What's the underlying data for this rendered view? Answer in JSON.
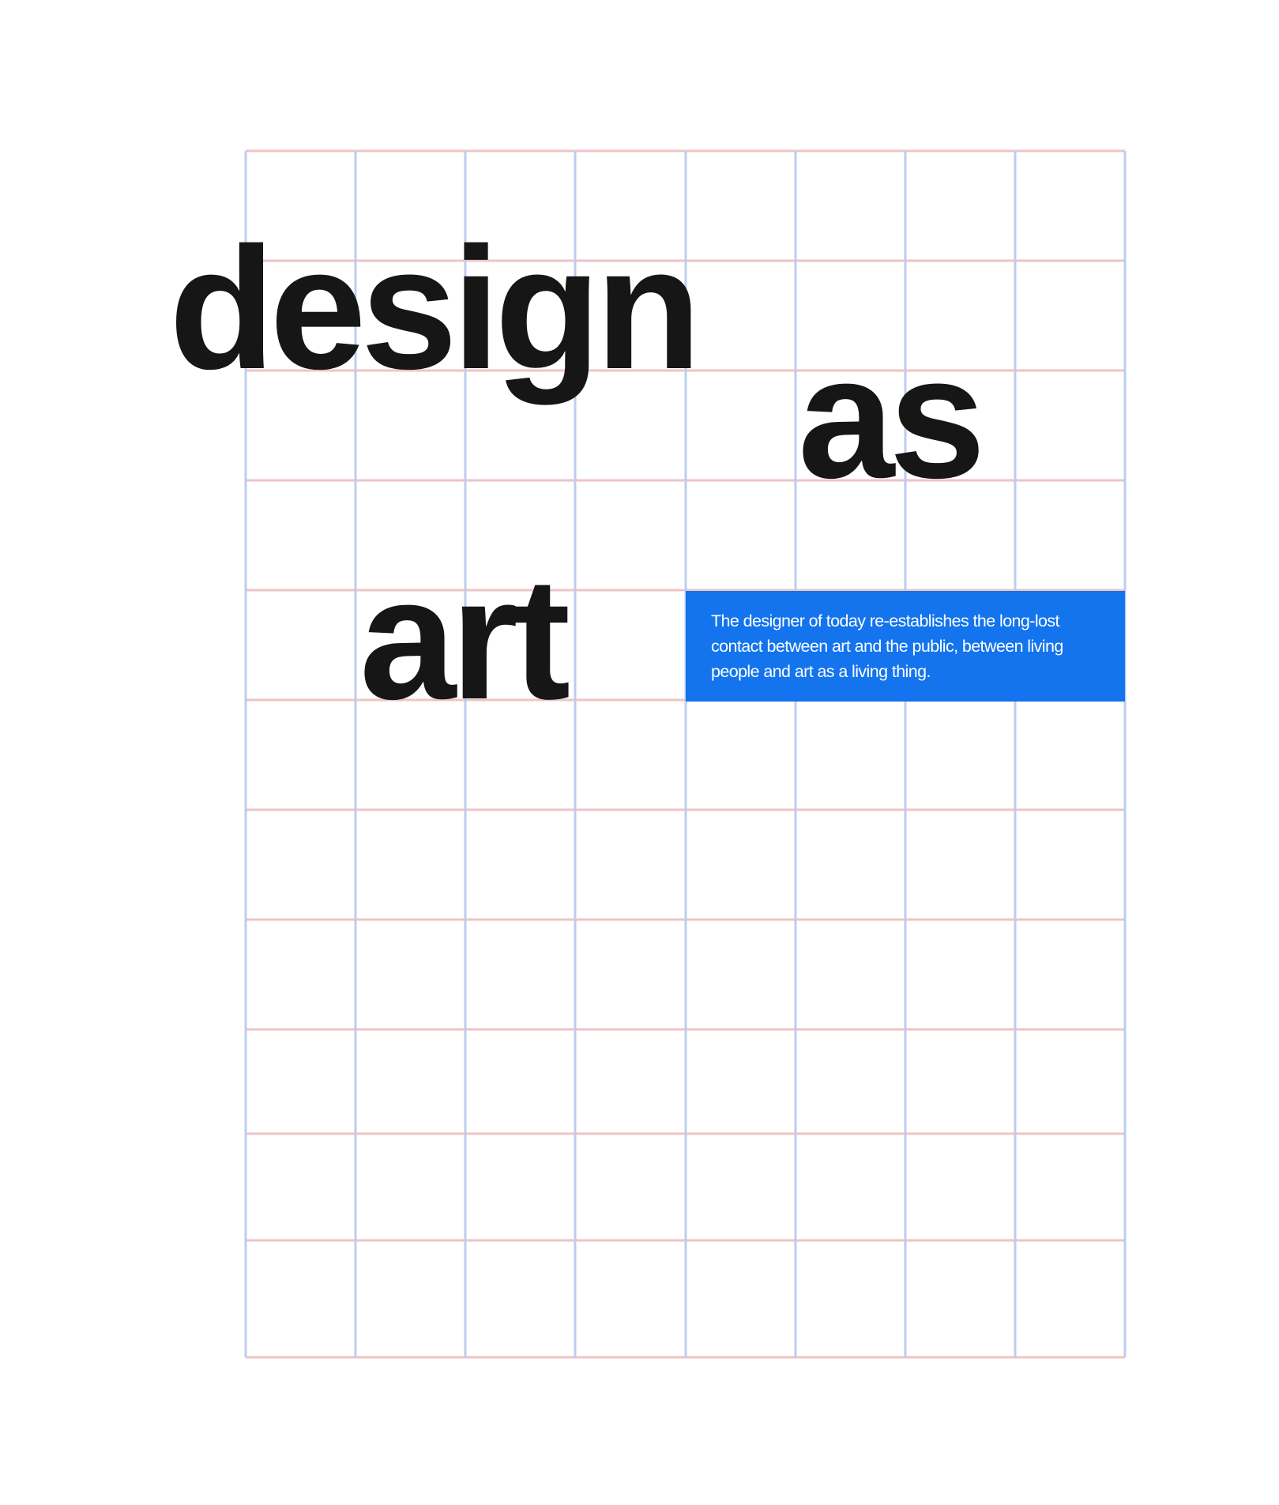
{
  "poster": {
    "words": {
      "design": "design",
      "as": "as",
      "art": "art"
    },
    "quote": "The designer of today re-establishes the long-lost contact between art and the public, between living people and art as a living thing."
  },
  "colors": {
    "background": "#ffffff",
    "text": "#161616",
    "accent_box": "#1374ee",
    "grid_horizontal": "#eec4c4",
    "grid_vertical": "#bccdf0"
  }
}
